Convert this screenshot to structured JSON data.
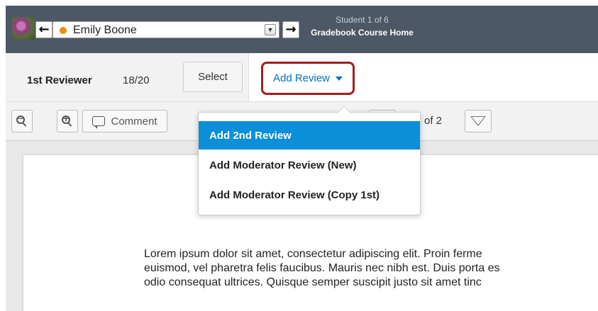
{
  "header": {
    "student_name": "Emily Boone",
    "student_count": "Student 1 of 6",
    "gradebook_link": "Gradebook Course Home",
    "status_color": "#f28c00"
  },
  "reviewer": {
    "label": "1st Reviewer",
    "score": "18/20",
    "select_label": "Select",
    "add_review_label": "Add Review"
  },
  "toolbar": {
    "comment_label": "Comment",
    "page_of": "of 2"
  },
  "dropdown": {
    "items": [
      {
        "label": "Add 2nd Review"
      },
      {
        "label": "Add Moderator Review (New)"
      },
      {
        "label": "Add Moderator Review (Copy 1st)"
      }
    ]
  },
  "document": {
    "lines": [
      "Lorem ipsum dolor sit amet, consectetur adipiscing elit. Proin ferme",
      "euismod, vel pharetra felis faucibus. Mauris nec nibh est. Duis porta es",
      "odio consequat ultrices. Quisque semper suscipit justo sit amet tinc"
    ]
  },
  "colors": {
    "header_bg": "#4d5866",
    "accent_blue": "#0070b8",
    "highlight_border": "#a11d1d",
    "menu_active": "#0a8fd8"
  }
}
